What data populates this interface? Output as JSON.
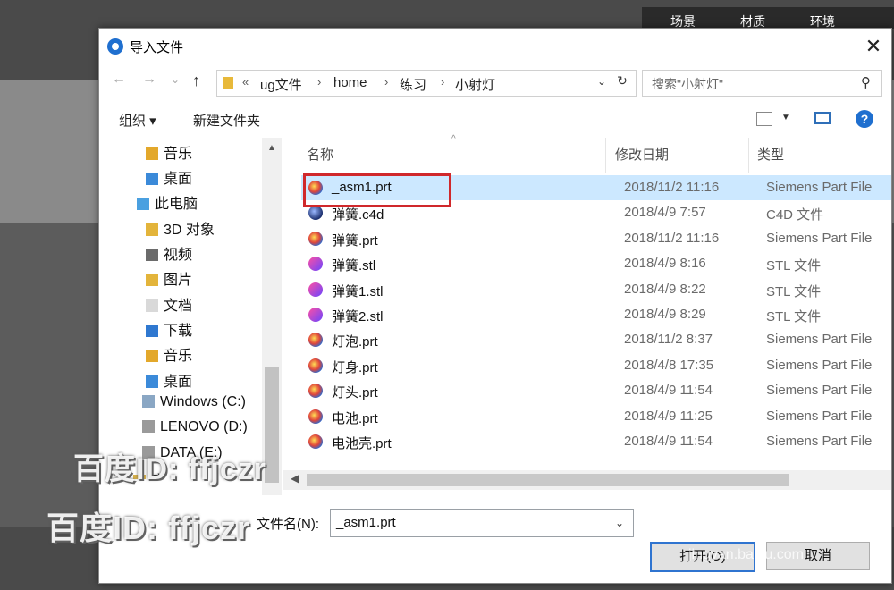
{
  "app_tabs": [
    "场景",
    "材质",
    "环境"
  ],
  "dialog": {
    "title": "导入文件",
    "close_label": "✕"
  },
  "nav": {
    "back": "←",
    "forward": "→",
    "recent": "⌄",
    "up": "↑",
    "breadcrumb_prefix": "«",
    "breadcrumb": [
      "ug文件",
      "home",
      "练习",
      "小射灯"
    ],
    "search_placeholder": "搜索\"小射灯\""
  },
  "toolbar": {
    "organize": "组织 ▾",
    "new_folder": "新建文件夹",
    "help": "?"
  },
  "sidebar": {
    "items": [
      {
        "label": "音乐",
        "icon": "music-folder-icon"
      },
      {
        "label": "桌面",
        "icon": "desktop-folder-icon"
      },
      {
        "label": "此电脑",
        "icon": "computer-icon"
      },
      {
        "label": "3D 对象",
        "icon": "3d-folder-icon"
      },
      {
        "label": "视频",
        "icon": "video-folder-icon"
      },
      {
        "label": "图片",
        "icon": "pictures-folder-icon"
      },
      {
        "label": "文档",
        "icon": "documents-folder-icon"
      },
      {
        "label": "下载",
        "icon": "downloads-folder-icon"
      },
      {
        "label": "音乐",
        "icon": "music-folder-icon"
      },
      {
        "label": "桌面",
        "icon": "desktop-folder-icon"
      },
      {
        "label": "Windows (C:)",
        "icon": "drive-icon"
      },
      {
        "label": "LENOVO (D:)",
        "icon": "drive-icon"
      },
      {
        "label": "DATA (E:)",
        "icon": "drive-icon"
      },
      {
        "label": "库",
        "icon": "library-icon"
      }
    ]
  },
  "columns": {
    "name": "名称",
    "date": "修改日期",
    "type": "类型"
  },
  "files": [
    {
      "name": "_asm1.prt",
      "date": "2018/11/2 11:16",
      "type": "Siemens Part File",
      "icon": "prt",
      "selected": true
    },
    {
      "name": "弹簧.c4d",
      "date": "2018/4/9 7:57",
      "type": "C4D 文件",
      "icon": "c4d"
    },
    {
      "name": "弹簧.prt",
      "date": "2018/11/2 11:16",
      "type": "Siemens Part File",
      "icon": "prt"
    },
    {
      "name": "弹簧.stl",
      "date": "2018/4/9 8:16",
      "type": "STL 文件",
      "icon": "stl"
    },
    {
      "name": "弹簧1.stl",
      "date": "2018/4/9 8:22",
      "type": "STL 文件",
      "icon": "stl"
    },
    {
      "name": "弹簧2.stl",
      "date": "2018/4/9 8:29",
      "type": "STL 文件",
      "icon": "stl"
    },
    {
      "name": "灯泡.prt",
      "date": "2018/11/2 8:37",
      "type": "Siemens Part File",
      "icon": "prt"
    },
    {
      "name": "灯身.prt",
      "date": "2018/4/8 17:35",
      "type": "Siemens Part File",
      "icon": "prt"
    },
    {
      "name": "灯头.prt",
      "date": "2018/4/9 11:54",
      "type": "Siemens Part File",
      "icon": "prt"
    },
    {
      "name": "电池.prt",
      "date": "2018/4/9 11:25",
      "type": "Siemens Part File",
      "icon": "prt"
    },
    {
      "name": "电池壳.prt",
      "date": "2018/4/9 11:54",
      "type": "Siemens Part File",
      "icon": "prt"
    }
  ],
  "bottom": {
    "filename_label": "文件名(N):",
    "filename_value": "_asm1.prt",
    "open_button": "打开(O)",
    "cancel_button": "取消"
  },
  "watermarks": {
    "main": "百度ID: ffjczr",
    "site": "jingyan.baidu.com"
  },
  "colors": {
    "selection": "#cce8ff",
    "highlight_box": "#d0282b",
    "accent": "#1f6fcf"
  }
}
